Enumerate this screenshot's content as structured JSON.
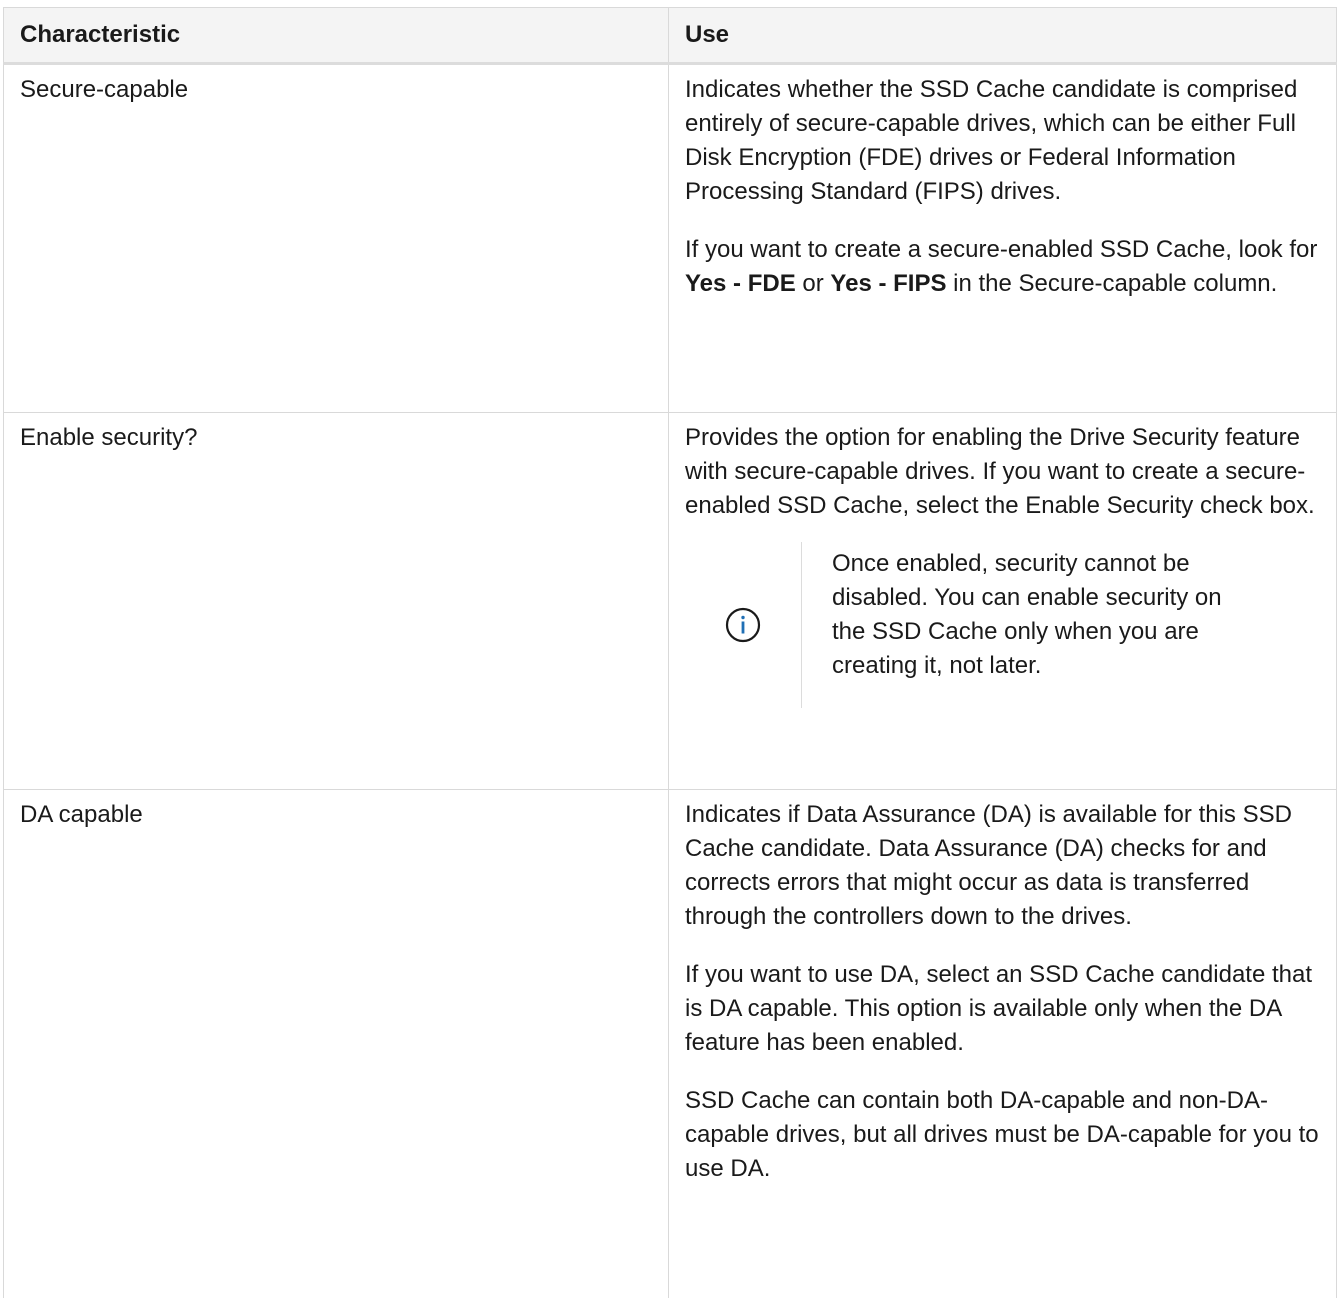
{
  "table": {
    "headers": [
      "Characteristic",
      "Use"
    ],
    "rows": [
      {
        "characteristic": "Secure-capable",
        "use_paragraph_1": "Indicates whether the SSD Cache candidate is comprised entirely of secure-capable drives, which can be either Full Disk Encryption (FDE) drives or Federal Information Processing Standard (FIPS) drives.",
        "use_paragraph_2": {
          "prefix": "If you want to create a secure-enabled SSD Cache, look for ",
          "bold_1": "Yes - FDE",
          "middle": " or ",
          "bold_2": "Yes - FIPS",
          "suffix": " in the Secure-capable column."
        }
      },
      {
        "characteristic": "Enable security?",
        "use_paragraph_1": "Provides the option for enabling the Drive Security feature with secure-capable drives. If you want to create a secure-enabled SSD Cache, select the Enable Security check box.",
        "note": {
          "icon": "info-icon",
          "text": "Once enabled, security cannot be disabled. You can enable security on the SSD Cache only when you are creating it, not later."
        }
      },
      {
        "characteristic": "DA capable",
        "use_paragraph_1": "Indicates if Data Assurance (DA) is available for this SSD Cache candidate. Data Assurance (DA) checks for and corrects errors that might occur as data is transferred through the controllers down to the drives.",
        "use_paragraph_2": "If you want to use DA, select an SSD Cache candidate that is DA capable. This option is available only when the DA feature has been enabled.",
        "use_paragraph_3": "SSD Cache can contain both DA-capable and non-DA-capable drives, but all drives must be DA-capable for you to use DA."
      }
    ]
  },
  "colors": {
    "info_icon": "#1f6fb5",
    "border": "#d9d9d9",
    "header_bg": "#f4f4f4"
  }
}
